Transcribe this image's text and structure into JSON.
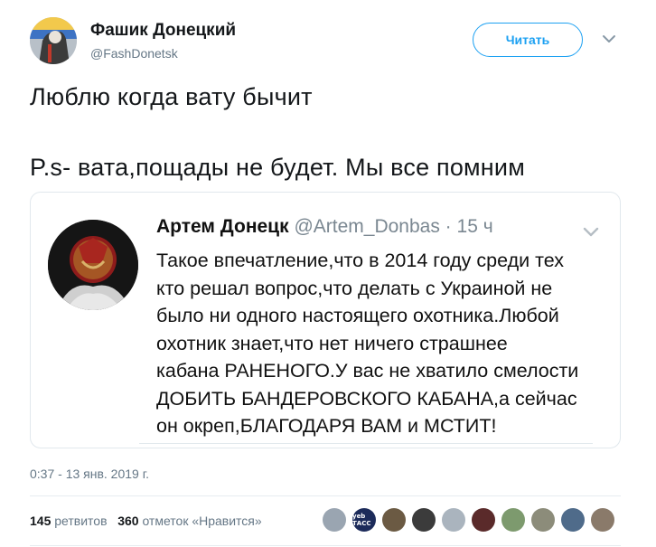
{
  "author": {
    "name": "Фашик Донецкий",
    "handle": "@FashDonetsk"
  },
  "follow_button": {
    "label": "Читать"
  },
  "tweet": {
    "lines": [
      "Люблю когда вату бычит",
      "P.s- вата,пощады не будет. Мы все помним"
    ],
    "timestamp": "0:37 - 13 янв. 2019 г."
  },
  "quoted_tweet": {
    "name": "Артем Донецк",
    "handle": "@Artem_Donbas",
    "separator": " · ",
    "time": "15 ч",
    "lines": [
      "Такое впечатление,что в 2014 году среди тех",
      "кто решал вопрос,что делать с Украиной не",
      "было ни одного настоящего охотника.Любой",
      "охотник знает,что нет ничего страшнее",
      "кабана РАНЕНОГО.У вас не хватило смелости",
      "ДОБИТЬ БАНДЕРОВСКОГО КАБАНА,а сейчас",
      "он окреп,БЛАГОДАРЯ ВАМ и МСТИТ!"
    ]
  },
  "stats": {
    "retweets_count": "145",
    "retweets_label": "ретвитов",
    "likes_count": "360",
    "likes_label": "отметок «Нравится»"
  },
  "likers": [
    {
      "color": "#9aa5b1",
      "label": ""
    },
    {
      "color": "#1c2b5a",
      "label": "yeb ТАСС"
    },
    {
      "color": "#6b5a43",
      "label": ""
    },
    {
      "color": "#3b3b3b",
      "label": ""
    },
    {
      "color": "#aab4be",
      "label": ""
    },
    {
      "color": "#5a2a2a",
      "label": ""
    },
    {
      "color": "#7d9a6e",
      "label": ""
    },
    {
      "color": "#8c8c7a",
      "label": ""
    },
    {
      "color": "#4f6b8a",
      "label": ""
    },
    {
      "color": "#8a7a6a",
      "label": ""
    }
  ]
}
